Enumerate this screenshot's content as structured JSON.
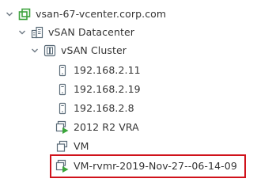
{
  "tree": {
    "vcenter": {
      "label": "vsan-67-vcenter.corp.com",
      "icon": "vcenter-icon"
    },
    "datacenter": {
      "label": "vSAN Datacenter",
      "icon": "datacenter-icon"
    },
    "cluster": {
      "label": "vSAN Cluster",
      "icon": "cluster-icon"
    },
    "hosts": [
      {
        "label": "192.168.2.11",
        "icon": "host-icon"
      },
      {
        "label": "192.168.2.19",
        "icon": "host-icon"
      },
      {
        "label": "192.168.2.8",
        "icon": "host-icon"
      }
    ],
    "vms": [
      {
        "label": "2012 R2 VRA",
        "icon": "vm-powered-on-icon"
      },
      {
        "label": "VM",
        "icon": "vm-icon"
      },
      {
        "label": "VM-rvmr-2019-Nov-27--06-14-09",
        "icon": "vm-powered-on-icon"
      }
    ]
  },
  "colors": {
    "vcenter_green": "#3fa33f",
    "icon_gray": "#5a6b78",
    "power_green": "#3aa53a",
    "chevron": "#6d7883",
    "highlight_red": "#d0121b"
  }
}
